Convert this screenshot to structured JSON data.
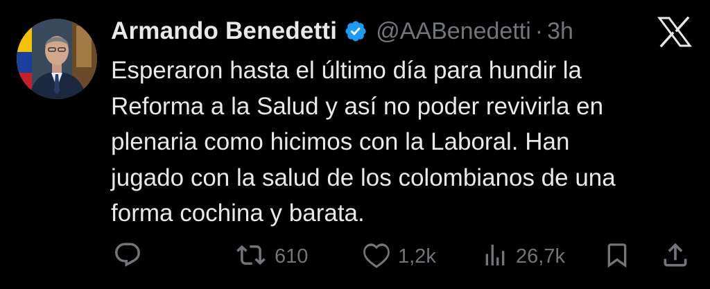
{
  "author": {
    "name": "Armando Benedetti",
    "handle": "@AABenedetti",
    "separator": "·",
    "time": "3h"
  },
  "tweet": {
    "lines": [
      "Esperaron hasta el último día para hundir la",
      "Reforma a la Salud y así no poder revivirla en",
      "plenaria como hicimos con la Laboral. Han",
      "jugado con la salud de los colombianos de una",
      "forma cochina y barata."
    ]
  },
  "actions": {
    "reply_count": "",
    "retweet_count": "610",
    "like_count": "1,2k",
    "view_count": "26,7k"
  },
  "icons": {
    "verified": "verified-badge-icon",
    "brand": "x-logo-icon",
    "reply": "reply-icon",
    "retweet": "retweet-icon",
    "like": "heart-icon",
    "views": "views-icon",
    "bookmark": "bookmark-icon",
    "share": "share-icon"
  },
  "colors": {
    "background": "#000000",
    "text": "#e7e9ea",
    "muted": "#71767b",
    "verified": "#1d9bf0"
  }
}
